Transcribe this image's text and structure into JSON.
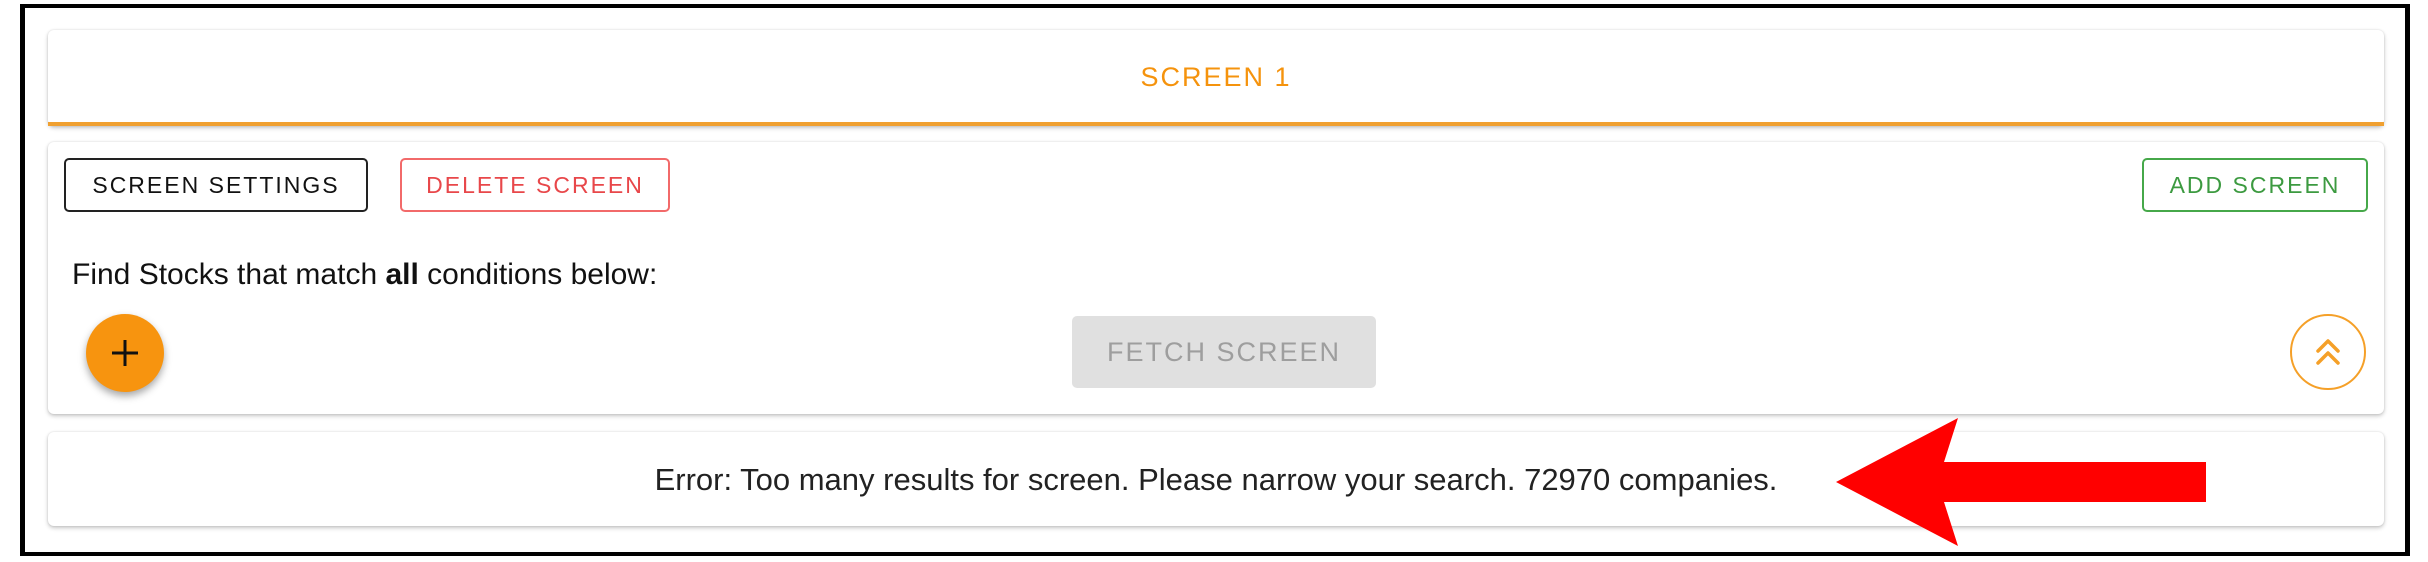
{
  "tab": {
    "title": "SCREEN 1"
  },
  "toolbar": {
    "settings_label": "SCREEN SETTINGS",
    "delete_label": "DELETE SCREEN",
    "add_label": "ADD SCREEN"
  },
  "conditions": {
    "prefix": "Find Stocks that match ",
    "emphasis": "all",
    "suffix": " conditions below:"
  },
  "actions": {
    "add_condition_icon": "plus-icon",
    "fetch_label": "FETCH SCREEN",
    "fetch_disabled": true,
    "collapse_icon": "double-chevron-up-icon"
  },
  "error": {
    "message": "Error: Too many results for screen. Please narrow your search. 72970 companies."
  },
  "annotation": {
    "icon": "red-arrow-left-icon"
  },
  "colors": {
    "accent": "#f5930d",
    "danger": "#e8474a",
    "success": "#3c9a40",
    "annotation": "#ff0000"
  }
}
